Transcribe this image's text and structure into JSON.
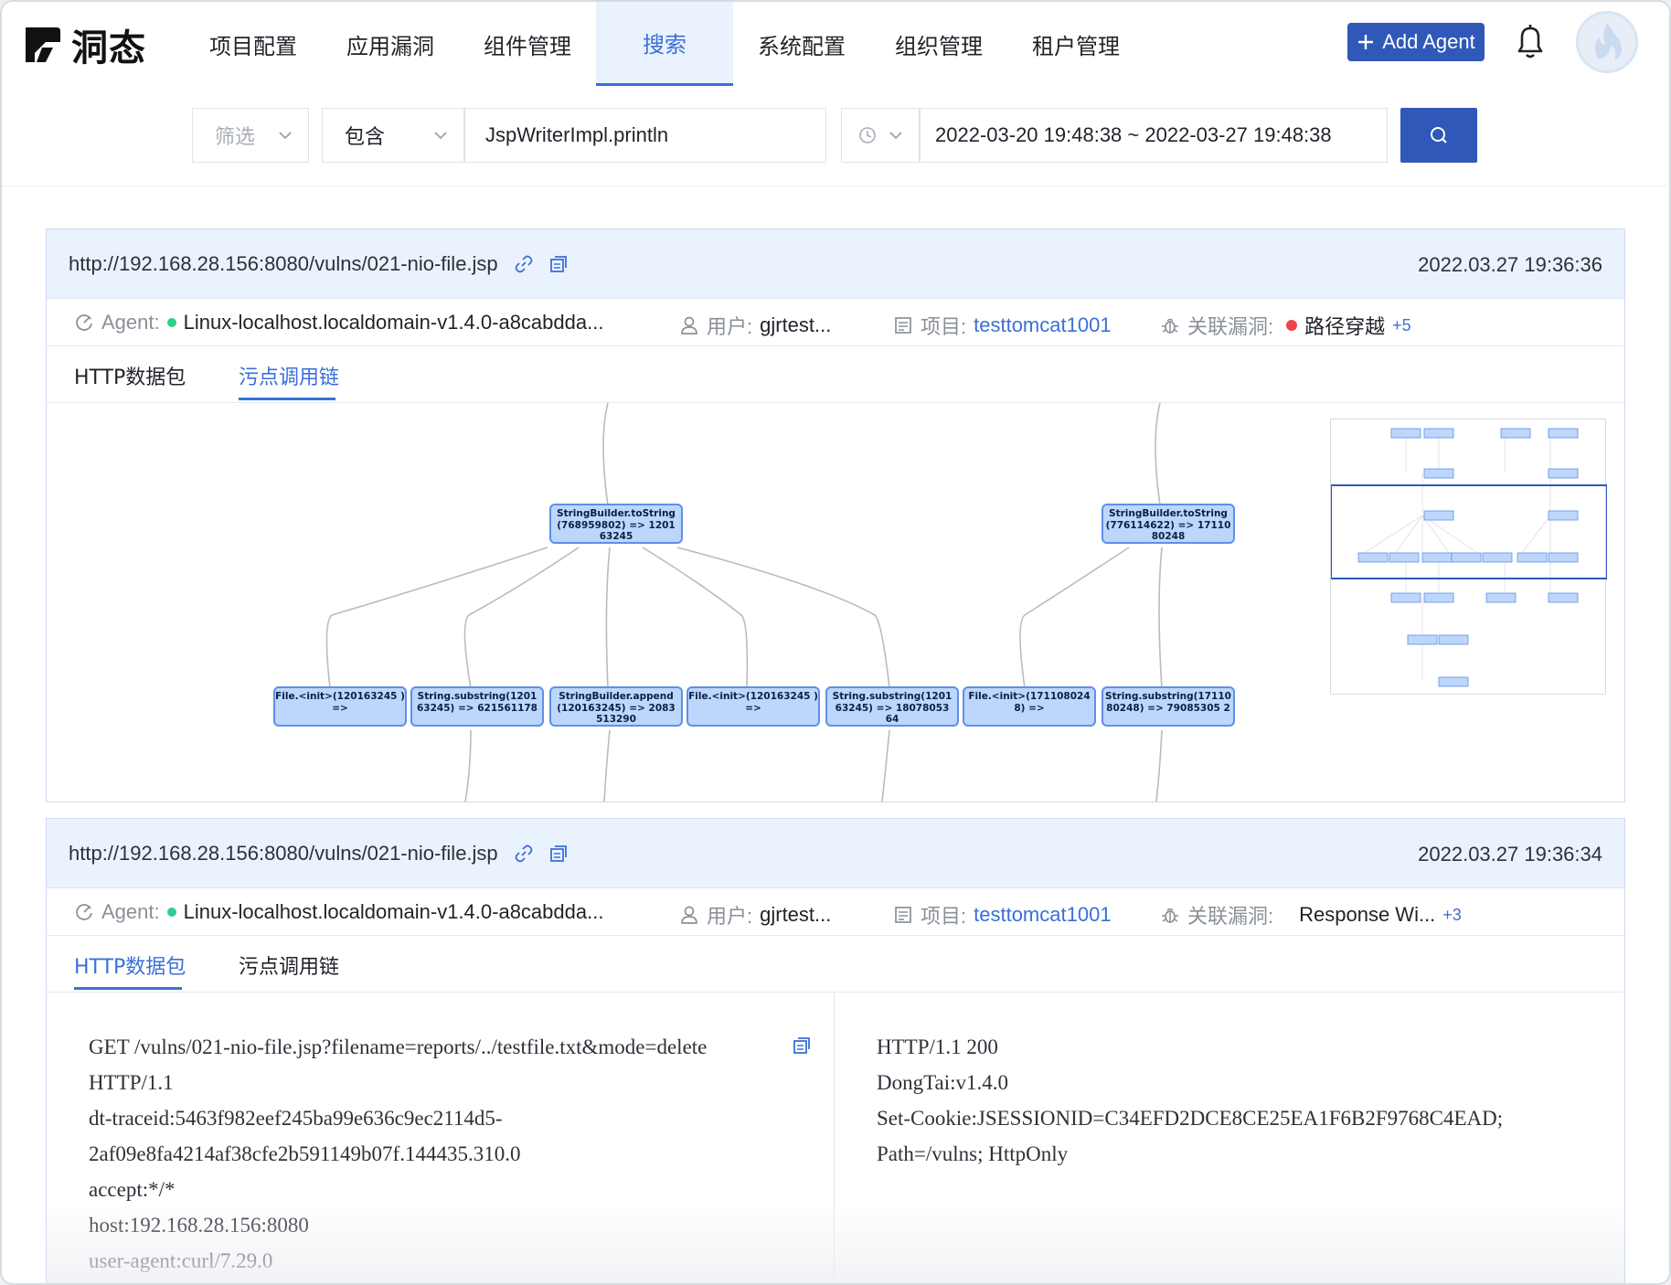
{
  "header": {
    "logo_text": "洞态",
    "nav": [
      "项目配置",
      "应用漏洞",
      "组件管理",
      "搜索",
      "系统配置",
      "组织管理",
      "租户管理"
    ],
    "active_nav": "搜索",
    "add_agent_label": "Add Agent",
    "icons": {
      "bell": "bell-icon",
      "avatar": "flame-avatar-icon"
    }
  },
  "search": {
    "filter_placeholder": "筛选",
    "operator": "包含",
    "query": "JspWriterImpl.println",
    "date_range": "2022-03-20 19:48:38 ~ 2022-03-27 19:48:38"
  },
  "results": [
    {
      "url": "http://192.168.28.156:8080/vulns/021-nio-file.jsp",
      "time": "2022.03.27 19:36:36",
      "agent_label": "Agent:",
      "agent": "Linux-localhost.localdomain-v1.4.0-a8cabdda...",
      "user_label": "用户:",
      "user": "gjrtest...",
      "project_label": "项目:",
      "project": "testtomcat1001",
      "vuln_label": "关联漏洞:",
      "vuln": "路径穿越",
      "vuln_more": "+5",
      "tabs": [
        "HTTP数据包",
        "污点调用链"
      ],
      "active_tab": "污点调用链",
      "graph_nodes": [
        "StringBuilder.toString (768959802) => 1201 63245",
        "StringBuilder.toString (776114622) => 17110 80248",
        "File.<init>(120163245 ) =>",
        "String.substring(1201 63245) => 621561178",
        "StringBuilder.append (120163245) => 2083 513290",
        "File.<init>(120163245 ) =>",
        "String.substring(1201 63245) => 18078053 64",
        "File.<init>(171108024 8) =>",
        "String.substring(17110 80248) => 79085305 2"
      ]
    },
    {
      "url": "http://192.168.28.156:8080/vulns/021-nio-file.jsp",
      "time": "2022.03.27 19:36:34",
      "agent_label": "Agent:",
      "agent": "Linux-localhost.localdomain-v1.4.0-a8cabdda...",
      "user_label": "用户:",
      "user": "gjrtest...",
      "project_label": "项目:",
      "project": "testtomcat1001",
      "vuln_label": "关联漏洞:",
      "vuln": "Response Wi...",
      "vuln_more": "+3",
      "tabs": [
        "HTTP数据包",
        "污点调用链"
      ],
      "active_tab": "HTTP数据包",
      "request_lines": [
        "GET /vulns/021-nio-file.jsp?filename=reports/../testfile.txt&mode=delete",
        "HTTP/1.1",
        "dt-traceid:5463f982eef245ba99e636c9ec2114d5-",
        "2af09e8fa4214af38cfe2b591149b07f.144435.310.0",
        "accept:*/*",
        "host:192.168.28.156:8080",
        "user-agent:curl/7.29.0"
      ],
      "response_lines": [
        "HTTP/1.1 200",
        "DongTai:v1.4.0",
        "Set-Cookie:JSESSIONID=C34EFD2DCE8CE25EA1F6B2F9768C4EAD;",
        "Path=/vulns; HttpOnly"
      ]
    }
  ],
  "colors": {
    "primary": "#2f58b9",
    "accent": "#3b6fd8",
    "node_fill": "#bcd7fb",
    "vuln_dot": "#f0454a",
    "agent_dot": "#2ccf8c"
  }
}
